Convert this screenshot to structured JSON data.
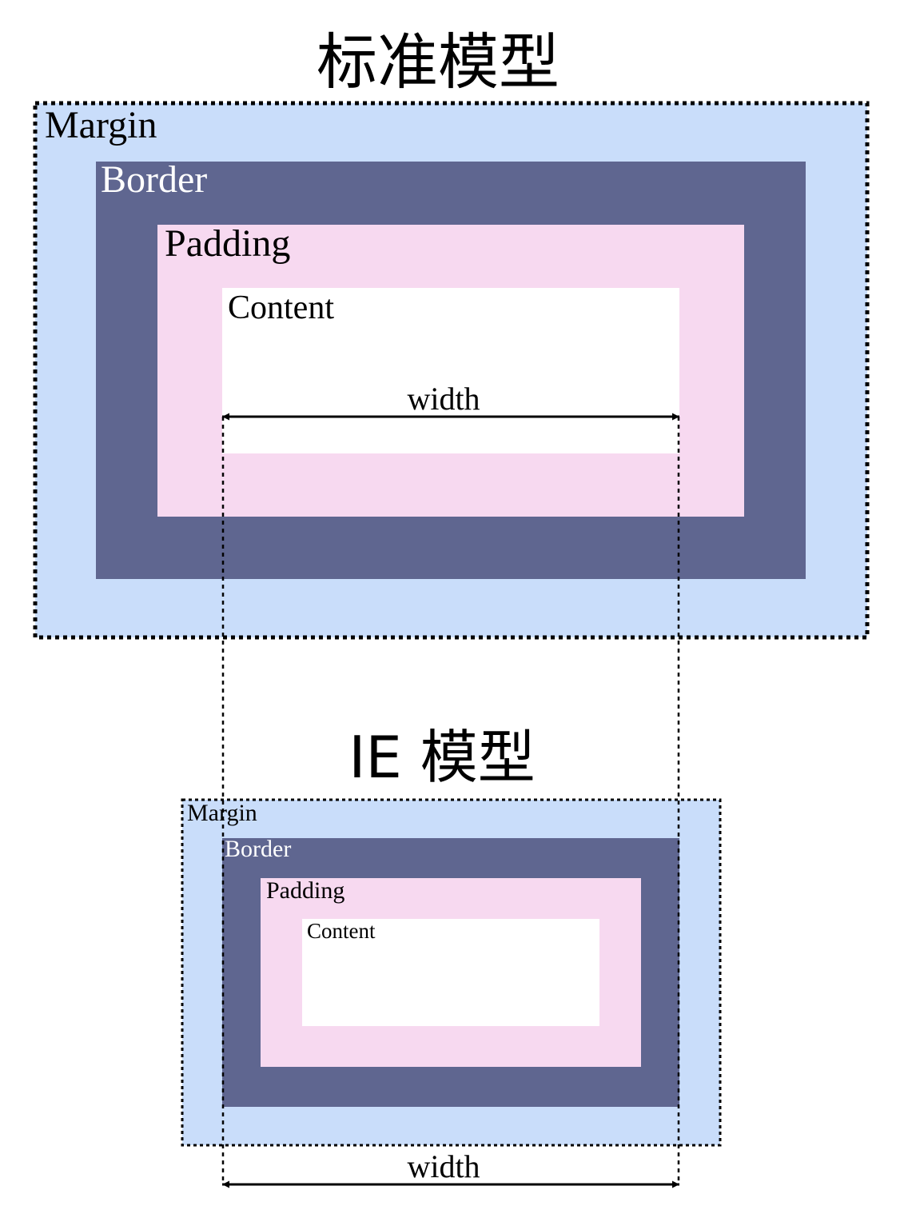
{
  "standard": {
    "title": "标准模型",
    "labels": {
      "margin": "Margin",
      "border": "Border",
      "padding": "Padding",
      "content": "Content"
    },
    "width_label": "width"
  },
  "ie": {
    "title": "IE 模型",
    "labels": {
      "margin": "Margin",
      "border": "Border",
      "padding": "Padding",
      "content": "Content"
    },
    "width_label": "width"
  },
  "colors": {
    "margin": "#c9ddfa",
    "border": "#5f6690",
    "padding": "#f7d9f0",
    "content": "#ffffff",
    "line": "#000000"
  }
}
